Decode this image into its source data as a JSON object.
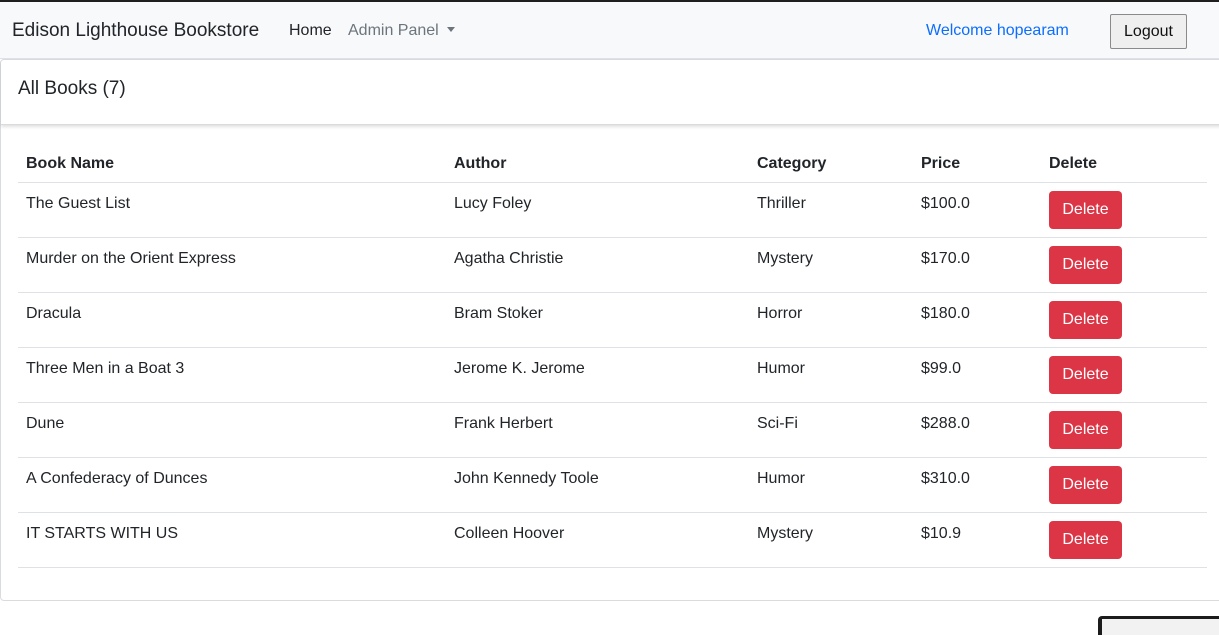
{
  "navbar": {
    "brand": "Edison Lighthouse Bookstore",
    "home_label": "Home",
    "admin_label": "Admin Panel",
    "welcome_text": "Welcome hopearam",
    "logout_label": "Logout"
  },
  "card": {
    "title": "All Books (7)"
  },
  "table": {
    "headers": {
      "name": "Book Name",
      "author": "Author",
      "category": "Category",
      "price": "Price",
      "delete": "Delete"
    },
    "rows": [
      {
        "name": "The Guest List",
        "author": "Lucy Foley",
        "category": "Thriller",
        "price": "$100.0",
        "action": "Delete"
      },
      {
        "name": "Murder on the Orient Express",
        "author": "Agatha Christie",
        "category": "Mystery",
        "price": "$170.0",
        "action": "Delete"
      },
      {
        "name": "Dracula",
        "author": "Bram Stoker",
        "category": "Horror",
        "price": "$180.0",
        "action": "Delete"
      },
      {
        "name": "Three Men in a Boat 3",
        "author": "Jerome K. Jerome",
        "category": "Humor",
        "price": "$99.0",
        "action": "Delete"
      },
      {
        "name": "Dune",
        "author": "Frank Herbert",
        "category": "Sci-Fi",
        "price": "$288.0",
        "action": "Delete"
      },
      {
        "name": "A Confederacy of Dunces",
        "author": "John Kennedy Toole",
        "category": "Humor",
        "price": "$310.0",
        "action": "Delete"
      },
      {
        "name": "IT STARTS WITH US",
        "author": "Colleen Hoover",
        "category": "Mystery",
        "price": "$10.9",
        "action": "Delete"
      }
    ]
  },
  "colors": {
    "link_blue": "#0d6efd",
    "delete_red": "#dc3545",
    "navbar_bg": "#f8f9fa"
  }
}
